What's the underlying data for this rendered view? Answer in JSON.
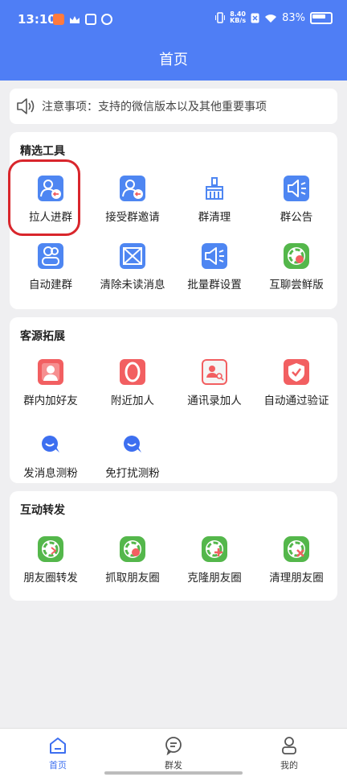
{
  "status_bar": {
    "time": "13:10",
    "net_speed_value": "8.40",
    "net_speed_unit": "KB/s",
    "battery": "83%"
  },
  "header": {
    "title": "首页"
  },
  "notice": {
    "text": "注意事项：支持的微信版本以及其他重要事项"
  },
  "sections": [
    {
      "title": "精选工具",
      "tools": [
        {
          "label": "拉人进群",
          "icon": "add-to-group-icon"
        },
        {
          "label": "接受群邀请",
          "icon": "accept-invite-icon"
        },
        {
          "label": "群清理",
          "icon": "broom-icon"
        },
        {
          "label": "群公告",
          "icon": "announcement-icon"
        },
        {
          "label": "自动建群",
          "icon": "auto-create-group-icon"
        },
        {
          "label": "清除未读消息",
          "icon": "clear-unread-icon"
        },
        {
          "label": "批量群设置",
          "icon": "batch-settings-icon"
        },
        {
          "label": "互聊尝鲜版",
          "icon": "moments-hand-icon"
        }
      ]
    },
    {
      "title": "客源拓展",
      "tools": [
        {
          "label": "群内加好友",
          "icon": "user-add-icon"
        },
        {
          "label": "附近加人",
          "icon": "location-icon"
        },
        {
          "label": "通讯录加人",
          "icon": "contacts-icon"
        },
        {
          "label": "自动通过验证",
          "icon": "shield-check-icon"
        },
        {
          "label": "发消息测粉",
          "icon": "chat-bubble-icon"
        },
        {
          "label": "免打扰测粉",
          "icon": "chat-bubble-icon"
        }
      ]
    },
    {
      "title": "互动转发",
      "tools": [
        {
          "label": "朋友圈转发",
          "icon": "moments-share-icon"
        },
        {
          "label": "抓取朋友圈",
          "icon": "moments-grab-icon"
        },
        {
          "label": "克隆朋友圈",
          "icon": "moments-clone-icon"
        },
        {
          "label": "清理朋友圈",
          "icon": "moments-clean-icon"
        }
      ]
    }
  ],
  "tabs": [
    {
      "label": "首页",
      "active": true
    },
    {
      "label": "群发",
      "active": false
    },
    {
      "label": "我的",
      "active": false
    }
  ],
  "colors": {
    "primary": "#4f7ef5",
    "icon_blue": "#4e86f2",
    "icon_green": "#54b74b",
    "icon_red": "#f25f61",
    "highlight": "#d9262c"
  }
}
